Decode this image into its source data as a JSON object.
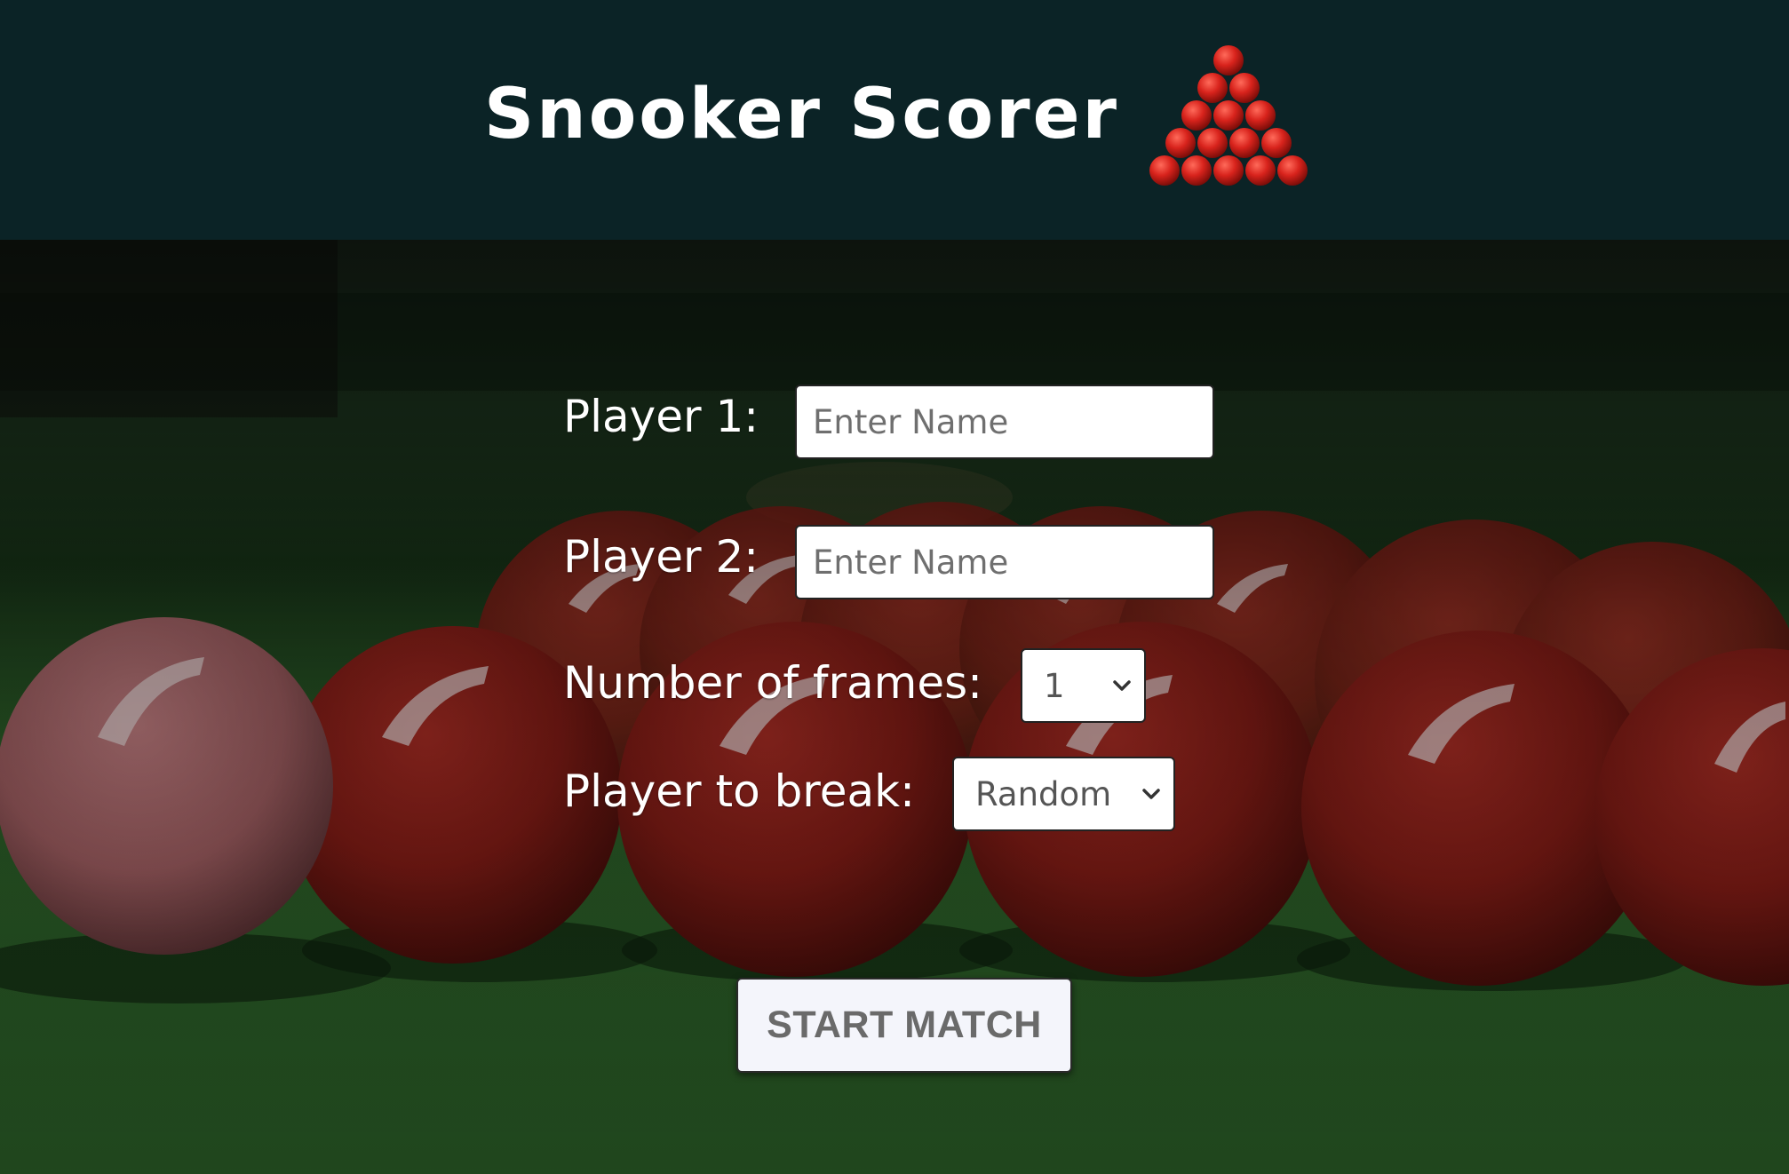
{
  "header": {
    "title": "Snooker Scorer",
    "icon": "snooker-rack-icon"
  },
  "form": {
    "player1": {
      "label": "Player 1:",
      "placeholder": "Enter Name",
      "value": ""
    },
    "player2": {
      "label": "Player 2:",
      "placeholder": "Enter Name",
      "value": ""
    },
    "frames": {
      "label": "Number of frames:",
      "selected": "1"
    },
    "breaker": {
      "label": "Player to break:",
      "selected": "Random"
    },
    "start_label": "START MATCH"
  },
  "colors": {
    "header_bg": "#0b2326",
    "ball_red": "#b3231c",
    "felt_green": "#2a5a26"
  }
}
